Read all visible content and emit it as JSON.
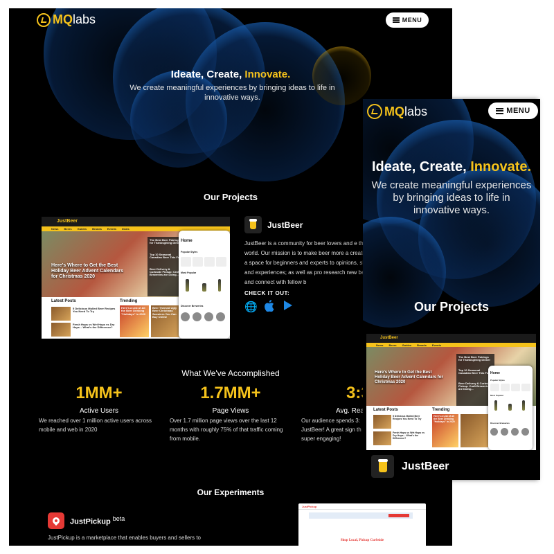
{
  "brand": {
    "mq": "MQ",
    "labs": "labs",
    "accent": "#f5c21b"
  },
  "menu_label": "MENU",
  "hero": {
    "title_prefix": "Ideate, Create, ",
    "title_accent": "Innovate.",
    "subtitle": "We create meaningful experiences by bringing ideas to life in innovative ways."
  },
  "projects": {
    "heading": "Our Projects",
    "justbeer": {
      "name": "JustBeer",
      "description": "JustBeer is a community for beer lovers and e the world. Our mission is to make beer more a creating a space for beginners and experts to opinions, skills and experiences; as well as pro research new beers and connect with fellow b",
      "check_label": "CHECK IT OUT:",
      "store_icons": [
        "globe-icon",
        "apple-icon",
        "play-store-icon"
      ],
      "mock": {
        "logo": "JustBeer",
        "nav": [
          "News",
          "Beers",
          "Guides",
          "Brands",
          "Events",
          "Deals"
        ],
        "headline": "Here's Where to Get the Best Holiday Beer Advent Calendars for Christmas 2020",
        "side_headlines": [
          "The Best Beer Pairings for Thanksgiving Dinner",
          "Top 10 Seasonal Canadian Beer This Fall",
          "Beer Delivery & Curbside Pickup: Craft Breweries are Doing..."
        ],
        "latest_posts": "Latest Posts",
        "trending": "Trending",
        "more": "More",
        "post1": "5 Delicious Mulled Beer Recipes You Need To Try",
        "post2": "Fresh Hops vs Wet Hops vs Dry Hops – What's the Difference?",
        "trend1": "Here's a List of All the Beer Drinking \"Holidays\" in 2020",
        "trend2": "Beer Themed Ugly Beer Christmas Sweaters You Can Buy Online",
        "phone_title": "Home",
        "phone_popular_styles": "Popular Styles",
        "phone_most_popular": "Most Popular",
        "phone_discover": "Discover Breweries"
      }
    }
  },
  "accomplished": {
    "heading": "What We've Accomplished",
    "stats": [
      {
        "value": "1MM+",
        "label": "Active Users",
        "desc": "We reached over 1 million active users across mobile and web in 2020"
      },
      {
        "value": "1.7MM+",
        "label": "Page Views",
        "desc": "Over 1.7 million page views over the last 12 months with roughly 75% of that traffic coming from mobile."
      },
      {
        "value": "3:3",
        "label": "Avg. Rea",
        "desc": "Our audience spends 3: JustBeer! A great sign th super engaging!"
      }
    ]
  },
  "experiments": {
    "heading": "Our Experiments",
    "justpickup": {
      "name": "JustPickup",
      "badge": "beta",
      "description": "JustPickup is a marketplace that enables buyers and sellers to",
      "mock_banner": "Shop Local, Pickup Curbside",
      "mock_logo": "JustPickup"
    }
  }
}
